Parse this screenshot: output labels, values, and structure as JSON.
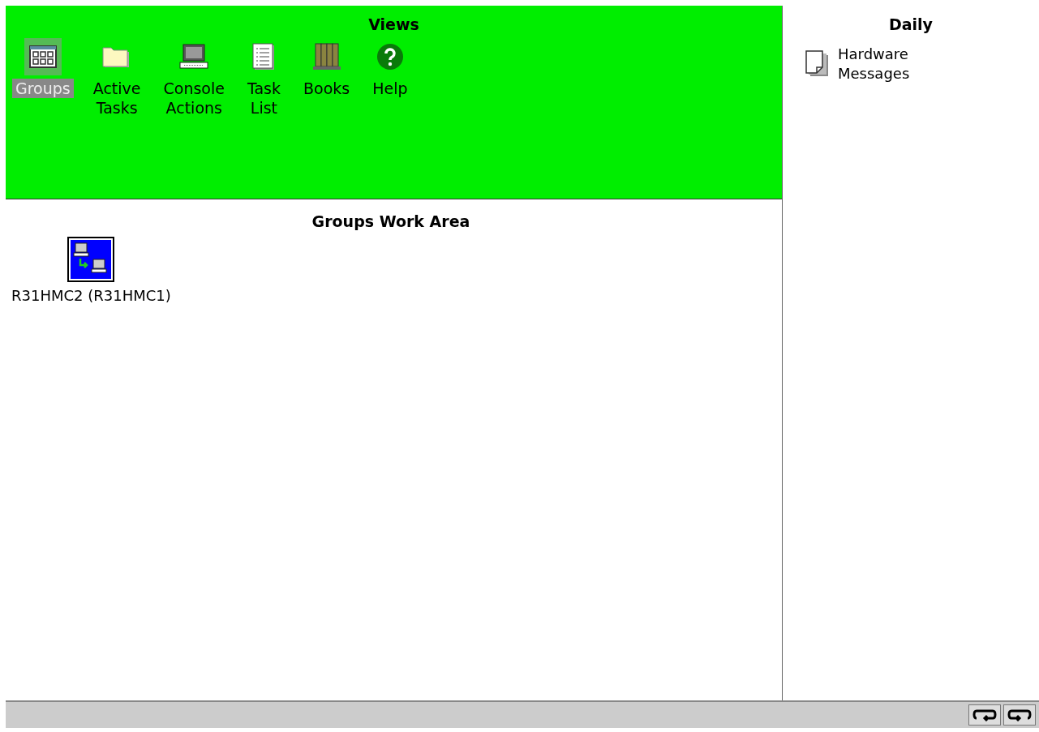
{
  "views": {
    "title": "Views",
    "items": [
      {
        "kind": "groups",
        "label": "Groups",
        "selected": true
      },
      {
        "kind": "folder",
        "label": "Active Tasks",
        "selected": false
      },
      {
        "kind": "computer",
        "label": "Console Actions",
        "selected": false
      },
      {
        "kind": "list",
        "label": "Task List",
        "selected": false
      },
      {
        "kind": "books",
        "label": "Books",
        "selected": false
      },
      {
        "kind": "help",
        "label": "Help",
        "selected": false
      }
    ]
  },
  "work_area": {
    "title": "Groups Work Area",
    "objects": [
      {
        "label": "R31HMC2 (R31HMC1)",
        "selected": true
      }
    ]
  },
  "daily": {
    "title": "Daily",
    "items": [
      {
        "label": "Hardware Messages"
      }
    ]
  }
}
